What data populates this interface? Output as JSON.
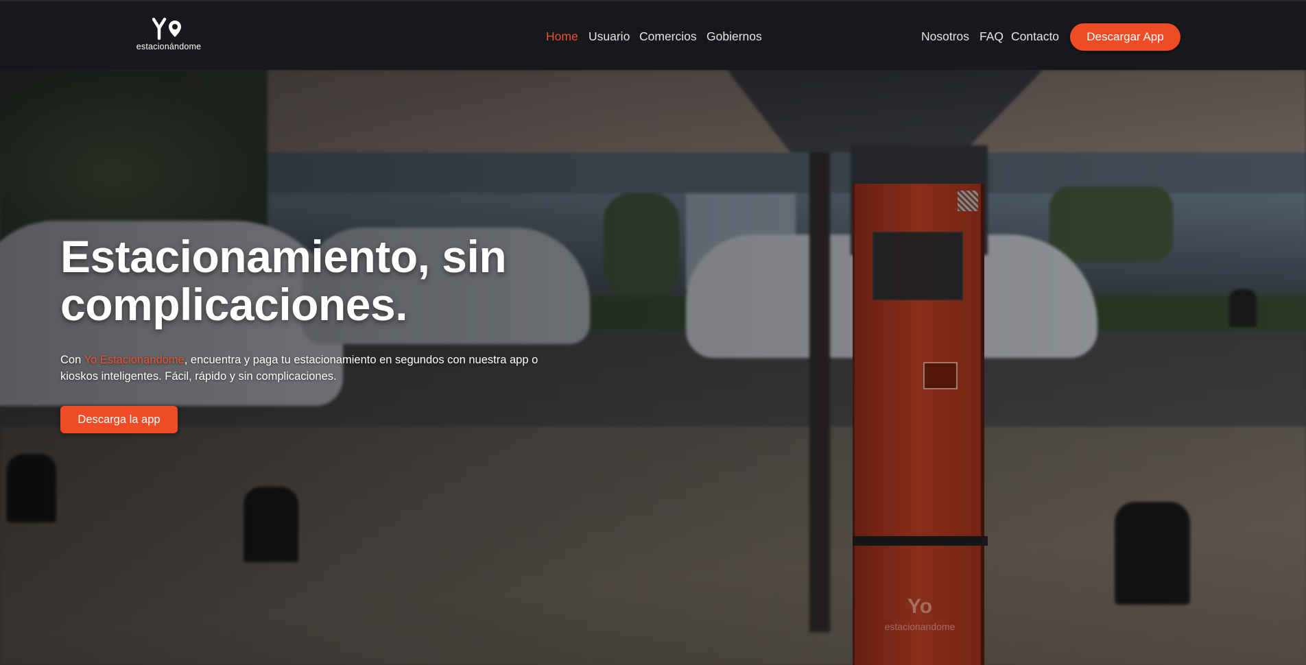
{
  "nav": {
    "logo_mark": "Yo",
    "logo_text": "estacionándome",
    "links_center": [
      "Home",
      "Usuario",
      "Comercios",
      "Gobiernos"
    ],
    "links_right": [
      "Nosotros",
      "FAQ",
      "Contacto"
    ],
    "cta_label": "Descargar App",
    "active": "Home"
  },
  "hero": {
    "title": "Estacionamiento, sin complicaciones.",
    "desc_prefix": "Con ",
    "desc_brand": "Yo Estacionándome",
    "desc_suffix": ", encuentra y paga tu estacionamiento en segundos con nuestra app o kioskos inteligentes. Fácil, rápido y sin complicaciones.",
    "cta_label": "Descarga la app"
  },
  "kiosk": {
    "logo_mark": "Yo",
    "logo_text": "estacionandome"
  },
  "colors": {
    "accent": "#ee4b26",
    "nav_bg": "#16181b"
  }
}
